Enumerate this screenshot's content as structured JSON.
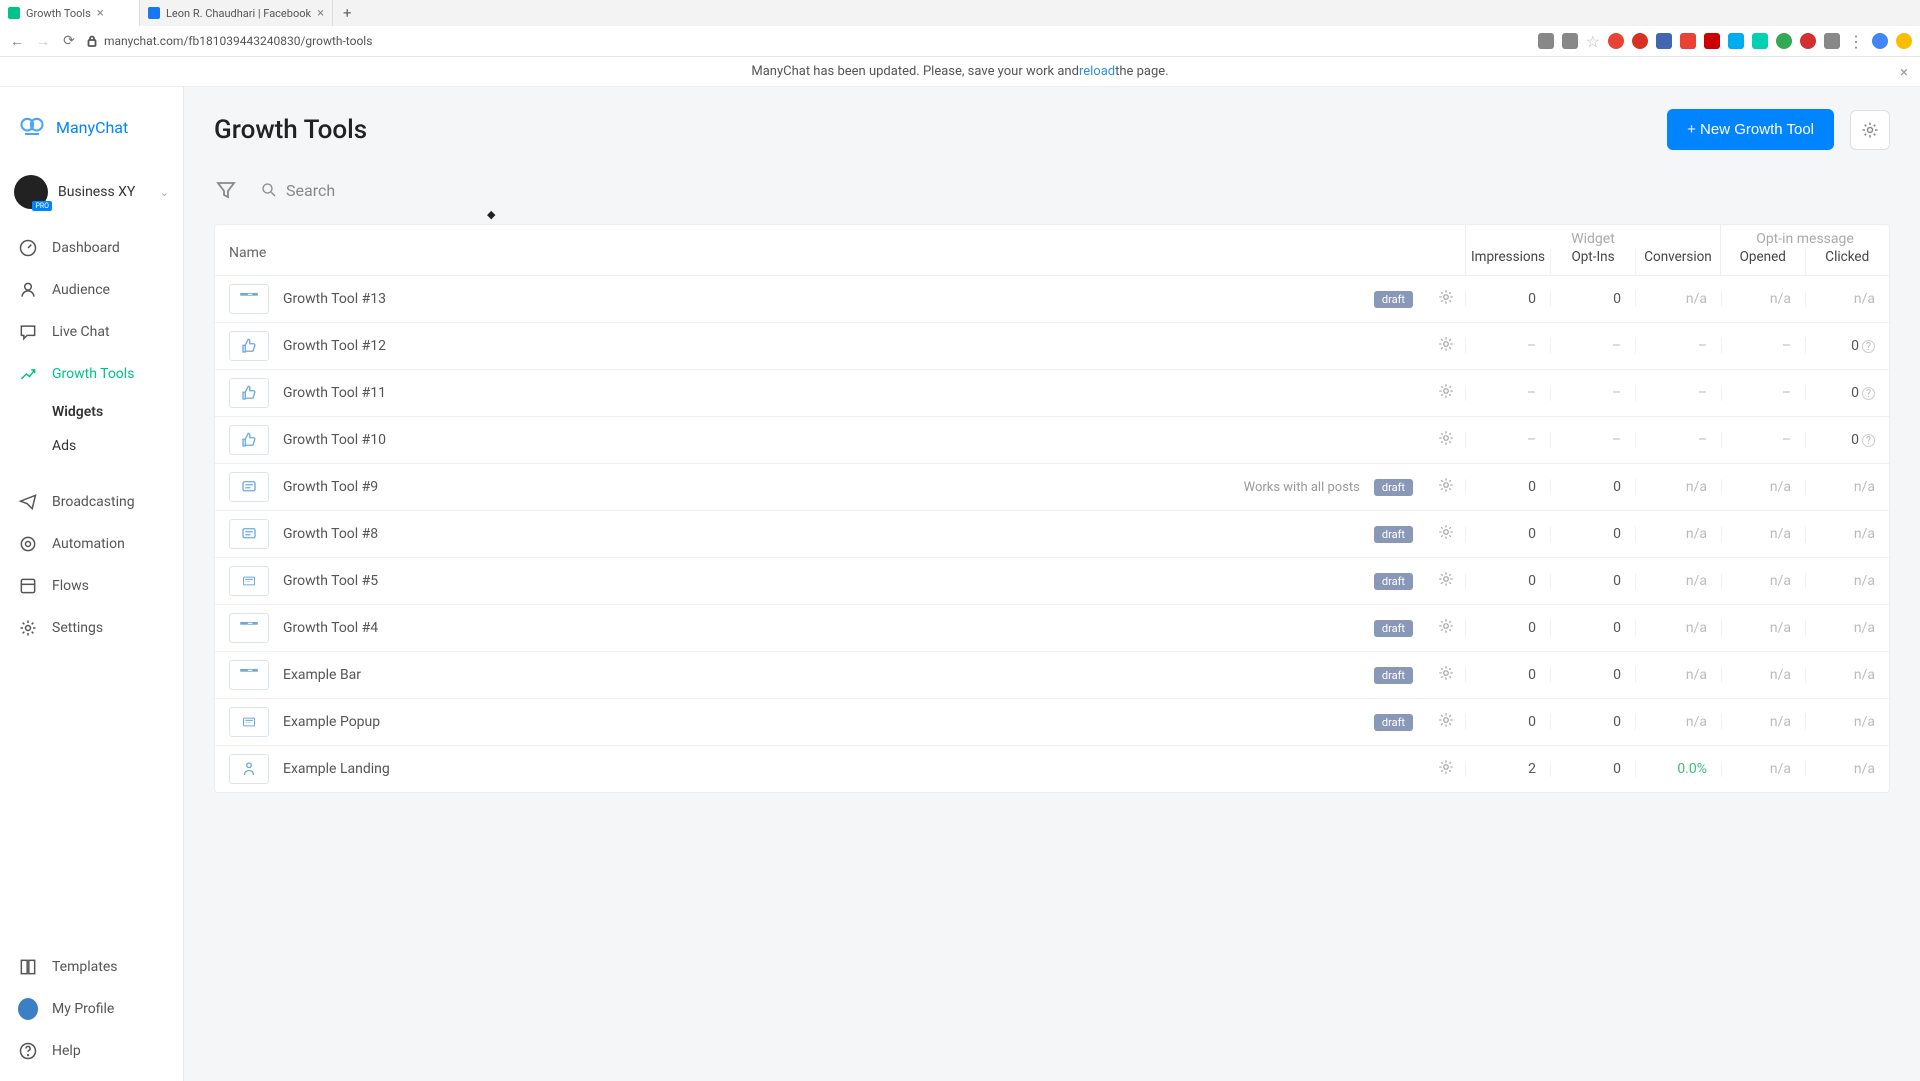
{
  "browser": {
    "tabs": [
      {
        "title": "Growth Tools",
        "active": true,
        "favicon": "#00c389"
      },
      {
        "title": "Leon R. Chaudhari | Facebook",
        "active": false,
        "favicon": "#1877f2"
      }
    ],
    "url": "manychat.com/fb181039443240830/growth-tools"
  },
  "banner": {
    "text_before": "ManyChat has been updated. Please, save your work and ",
    "link": "reload",
    "text_after": " the page."
  },
  "brand": "ManyChat",
  "account": {
    "name": "Business XY"
  },
  "nav": {
    "dashboard": "Dashboard",
    "audience": "Audience",
    "livechat": "Live Chat",
    "growthtools": "Growth Tools",
    "widgets": "Widgets",
    "ads": "Ads",
    "broadcasting": "Broadcasting",
    "automation": "Automation",
    "flows": "Flows",
    "settings": "Settings",
    "templates": "Templates",
    "myprofile": "My Profile",
    "help": "Help"
  },
  "page": {
    "title": "Growth Tools",
    "new_button": "+ New Growth Tool",
    "search_placeholder": "Search"
  },
  "table": {
    "name_header": "Name",
    "widget_group": "Widget",
    "optin_group": "Opt-in message",
    "cols": {
      "impressions": "Impressions",
      "optins": "Opt-Ins",
      "conversion": "Conversion",
      "opened": "Opened",
      "clicked": "Clicked"
    },
    "rows": [
      {
        "icon": "bar",
        "name": "Growth Tool #13",
        "note": "",
        "badge": "draft",
        "imp": "0",
        "opt": "0",
        "conv": "n/a",
        "open": "n/a",
        "click": "n/a",
        "info": false
      },
      {
        "icon": "thumb",
        "name": "Growth Tool #12",
        "note": "",
        "badge": "",
        "imp": "–",
        "opt": "–",
        "conv": "–",
        "open": "–",
        "click": "0",
        "info": true
      },
      {
        "icon": "thumb",
        "name": "Growth Tool #11",
        "note": "",
        "badge": "",
        "imp": "–",
        "opt": "–",
        "conv": "–",
        "open": "–",
        "click": "0",
        "info": true
      },
      {
        "icon": "thumb",
        "name": "Growth Tool #10",
        "note": "",
        "badge": "",
        "imp": "–",
        "opt": "–",
        "conv": "–",
        "open": "–",
        "click": "0",
        "info": true
      },
      {
        "icon": "chat",
        "name": "Growth Tool #9",
        "note": "Works with all posts",
        "badge": "draft",
        "imp": "0",
        "opt": "0",
        "conv": "n/a",
        "open": "n/a",
        "click": "n/a",
        "info": false
      },
      {
        "icon": "chat",
        "name": "Growth Tool #8",
        "note": "",
        "badge": "draft",
        "imp": "0",
        "opt": "0",
        "conv": "n/a",
        "open": "n/a",
        "click": "n/a",
        "info": false
      },
      {
        "icon": "popup",
        "name": "Growth Tool #5",
        "note": "",
        "badge": "draft",
        "imp": "0",
        "opt": "0",
        "conv": "n/a",
        "open": "n/a",
        "click": "n/a",
        "info": false
      },
      {
        "icon": "bar",
        "name": "Growth Tool #4",
        "note": "",
        "badge": "draft",
        "imp": "0",
        "opt": "0",
        "conv": "n/a",
        "open": "n/a",
        "click": "n/a",
        "info": false
      },
      {
        "icon": "bar",
        "name": "Example Bar",
        "note": "",
        "badge": "draft",
        "imp": "0",
        "opt": "0",
        "conv": "n/a",
        "open": "n/a",
        "click": "n/a",
        "info": false
      },
      {
        "icon": "popup",
        "name": "Example Popup",
        "note": "",
        "badge": "draft",
        "imp": "0",
        "opt": "0",
        "conv": "n/a",
        "open": "n/a",
        "click": "n/a",
        "info": false
      },
      {
        "icon": "landing",
        "name": "Example Landing",
        "note": "",
        "badge": "",
        "imp": "2",
        "opt": "0",
        "conv": "0.0%",
        "open": "n/a",
        "click": "n/a",
        "info": false,
        "conv_green": true
      }
    ]
  }
}
